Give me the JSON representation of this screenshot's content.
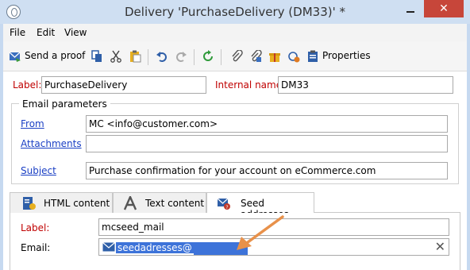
{
  "window": {
    "title": "Delivery 'PurchaseDelivery (DM33)' *",
    "close_label": "✕"
  },
  "menu": [
    "File",
    "Edit",
    "View"
  ],
  "toolbar": {
    "send_proof_label": "Send a proof",
    "properties_label": "Properties"
  },
  "form": {
    "label_caption": "Label:",
    "label_value": "PurchaseDelivery",
    "internal_name_caption": "Internal name:",
    "internal_name_value": "DM33"
  },
  "email_parameters": {
    "title": "Email parameters",
    "from_caption": "From",
    "from_value": "MC <info@customer.com>",
    "attachments_caption": "Attachments",
    "attachments_value": "",
    "subject_caption": "Subject",
    "subject_value": "Purchase confirmation for your account on eCommerce.com"
  },
  "tabs": [
    {
      "label": "HTML content",
      "icon": "html-doc-icon"
    },
    {
      "label": "Text content",
      "icon": "text-A-icon"
    },
    {
      "label": "Seed addresses",
      "icon": "seed-envelope-icon"
    }
  ],
  "seed": {
    "label_caption": "Label:",
    "label_value": "mcseed_mail",
    "email_caption": "Email:",
    "email_value": "seedadresses@"
  },
  "colors": {
    "accent_selection": "#3d73d9",
    "required_label": "#c00000",
    "link": "#1a3fc4",
    "arrow": "#e8914a"
  }
}
